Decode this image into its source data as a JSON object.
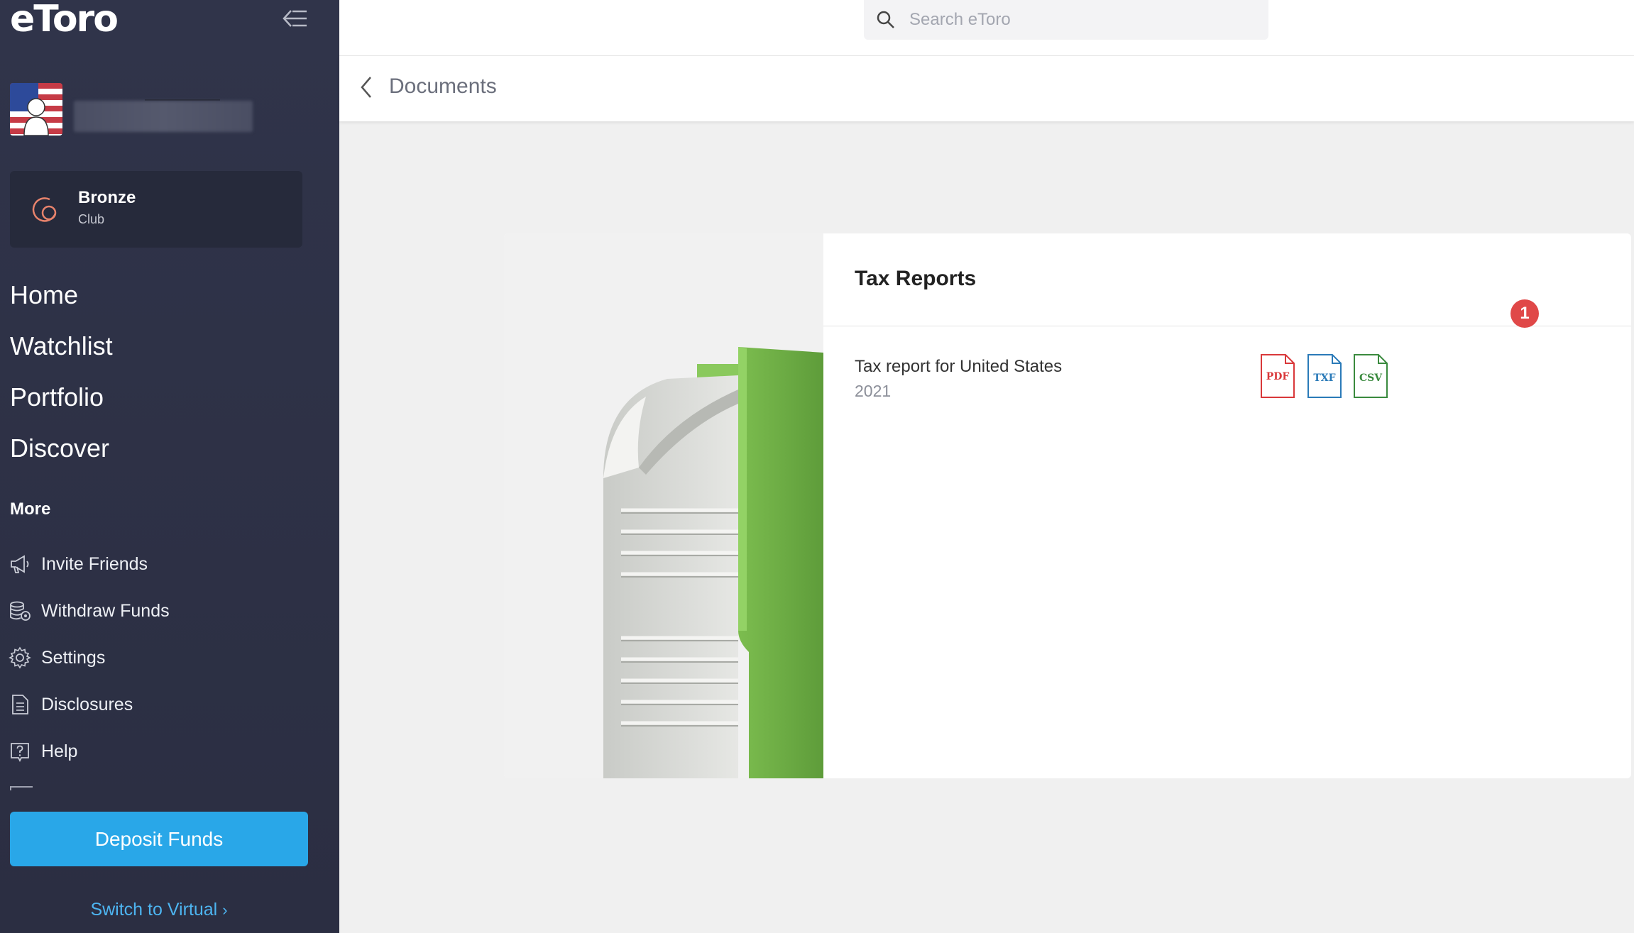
{
  "app": {
    "logo_text": "eToro"
  },
  "sidebar": {
    "club": {
      "title": "Bronze",
      "subtitle": "Club"
    },
    "main_nav": [
      {
        "label": "Home"
      },
      {
        "label": "Watchlist"
      },
      {
        "label": "Portfolio"
      },
      {
        "label": "Discover"
      }
    ],
    "more_label": "More",
    "more_nav": [
      {
        "label": "Invite Friends",
        "icon": "megaphone-icon"
      },
      {
        "label": "Withdraw Funds",
        "icon": "coins-icon"
      },
      {
        "label": "Settings",
        "icon": "gear-icon"
      },
      {
        "label": "Disclosures",
        "icon": "document-icon"
      },
      {
        "label": "Help",
        "icon": "help-icon"
      }
    ],
    "deposit_label": "Deposit Funds",
    "switch_virtual_label": "Switch to Virtual"
  },
  "search": {
    "placeholder": "Search eToro"
  },
  "header": {
    "title": "Documents"
  },
  "tax_reports": {
    "title": "Tax Reports",
    "report_name": "Tax report for United States",
    "report_year": "2021",
    "badge": "1",
    "formats": [
      "PDF",
      "TXF",
      "CSV"
    ]
  },
  "colors": {
    "sidebar_bg": "#2d3044",
    "accent_blue": "#29a7e8",
    "link_blue": "#4db4f0",
    "pdf_red": "#d9383a",
    "txf_blue": "#2a7ab8",
    "csv_green": "#3a8a3e",
    "badge_red": "#e04848",
    "folder_green": "#6aaa45"
  }
}
